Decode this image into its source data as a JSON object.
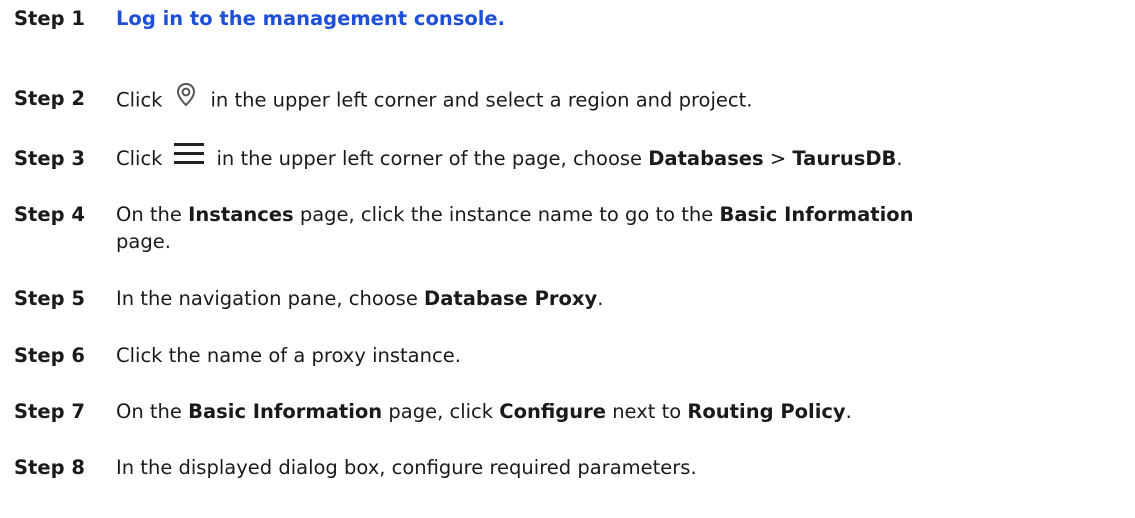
{
  "steps": [
    {
      "label": "Step 1",
      "link": "Log in to the management console."
    },
    {
      "label": "Step 2",
      "pre": "Click",
      "icon": "location-pin-icon",
      "post": "in the upper left corner and select a region and project."
    },
    {
      "label": "Step 3",
      "pre": "Click",
      "icon": "hamburger-menu-icon",
      "mid": "in the upper left corner of the page, choose",
      "b1": "Databases",
      "sep": ">",
      "b2": "TaurusDB",
      "end": "."
    },
    {
      "label": "Step 4",
      "pre": "On the",
      "b1": "Instances",
      "mid": "page, click the instance name to go to the",
      "b2": "Basic Information",
      "cont": "page."
    },
    {
      "label": "Step 5",
      "pre": "In the navigation pane, choose",
      "b1": "Database Proxy",
      "end": "."
    },
    {
      "label": "Step 6",
      "text": "Click the name of a proxy instance."
    },
    {
      "label": "Step 7",
      "pre": "On the",
      "b1": "Basic Information",
      "mid": "page, click",
      "b2": "Configure",
      "mid2": "next to",
      "b3": "Routing Policy",
      "end": "."
    },
    {
      "label": "Step 8",
      "text": "In the displayed dialog box, configure required parameters."
    }
  ]
}
